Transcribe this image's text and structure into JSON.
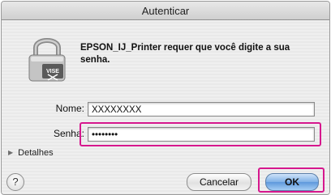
{
  "window": {
    "title": "Autenticar"
  },
  "message": "EPSON_IJ_Printer requer que você digite a sua senha.",
  "form": {
    "name_label": "Nome:",
    "name_value": "XXXXXXXX",
    "password_label": "Senha:",
    "password_mask": "••••••••"
  },
  "details_label": "Detalhes",
  "help_label": "?",
  "buttons": {
    "cancel": "Cancelar",
    "ok": "OK"
  },
  "lock_badge": "VISE",
  "colors": {
    "highlight": "#d6178d",
    "default_button": "#5e98dc"
  },
  "icons": {
    "lock": "lock-icon",
    "disclosure": "disclosure-triangle-icon",
    "help": "help-icon"
  }
}
